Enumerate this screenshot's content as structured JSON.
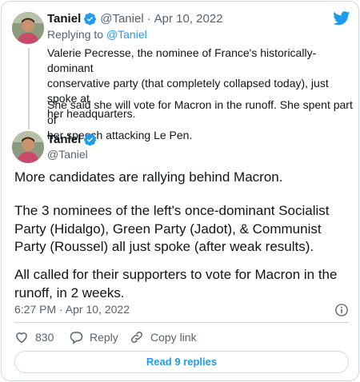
{
  "tweet1": {
    "name": "Taniel",
    "handle": "@Taniel",
    "separator": "·",
    "date": "Apr 10, 2022",
    "replying_prefix": "Replying to",
    "replying_to": "@Taniel",
    "para1_line1": "Valerie Pecresse, the nominee of France's historically-dominant",
    "para1_line2": "conservative party (that completely collapsed today), just spoke at",
    "para1_line3": "her headquarters.",
    "para2_line1": "She said she will vote for Macron in the runoff. She spent part of",
    "para2_line2": "her speech attacking Le Pen."
  },
  "tweet2": {
    "name": "Taniel",
    "handle": "@Taniel",
    "para1": "More candidates are rallying behind Macron.",
    "para2_line1": "The 3 nominees of the left's once-dominant Socialist",
    "para2_line2": "Party (Hidalgo), Green Party (Jadot), & Communist",
    "para2_line3": "Party (Roussel) all just spoke (after weak results).",
    "para3_line1": "All called for their supporters to vote for Macron in the",
    "para3_line2": "runoff, in 2 weeks.",
    "timestamp": "6:27 PM · Apr 10, 2022"
  },
  "actions": {
    "like_count": "830",
    "reply_label": "Reply",
    "copy_label": "Copy link"
  },
  "read_replies": "Read 9 replies",
  "colors": {
    "accent": "#1d9bf0",
    "muted": "#536471",
    "border": "#cfd9de"
  }
}
